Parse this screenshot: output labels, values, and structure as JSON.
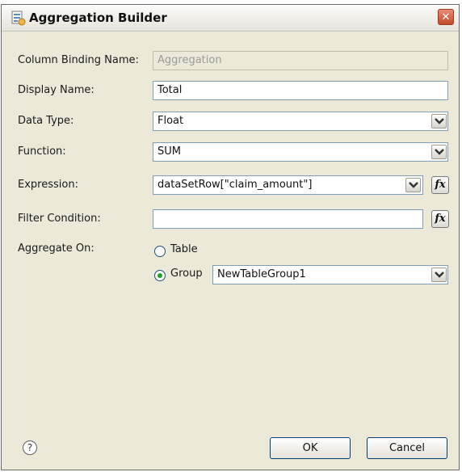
{
  "window": {
    "title": "Aggregation Builder",
    "close_glyph": "✕"
  },
  "fields": {
    "column_binding_name": {
      "label": "Column Binding Name:",
      "value": "Aggregation"
    },
    "display_name": {
      "label": "Display Name:",
      "value": "Total"
    },
    "data_type": {
      "label": "Data Type:",
      "value": "Float"
    },
    "function": {
      "label": "Function:",
      "value": "SUM"
    },
    "expression": {
      "label": "Expression:",
      "value": "dataSetRow[\"claim_amount\"]"
    },
    "filter_condition": {
      "label": "Filter Condition:",
      "value": ""
    }
  },
  "aggregate_on": {
    "label": "Aggregate On:",
    "table_label": "Table",
    "group_label": "Group",
    "group_value": "NewTableGroup1",
    "selected": "group"
  },
  "buttons": {
    "ok": "OK",
    "cancel": "Cancel",
    "help_glyph": "?"
  },
  "icons": {
    "title_icon": "builder-icon",
    "dropdown_icon": "chevron-down-icon",
    "expression_builder_icon": "fx-icon",
    "help_icon": "help-icon"
  },
  "colors": {
    "dialog_bg": "#ece9d8",
    "input_border": "#7f9db9",
    "radio_selected": "#21a121",
    "close_button": "#c24a2c"
  }
}
